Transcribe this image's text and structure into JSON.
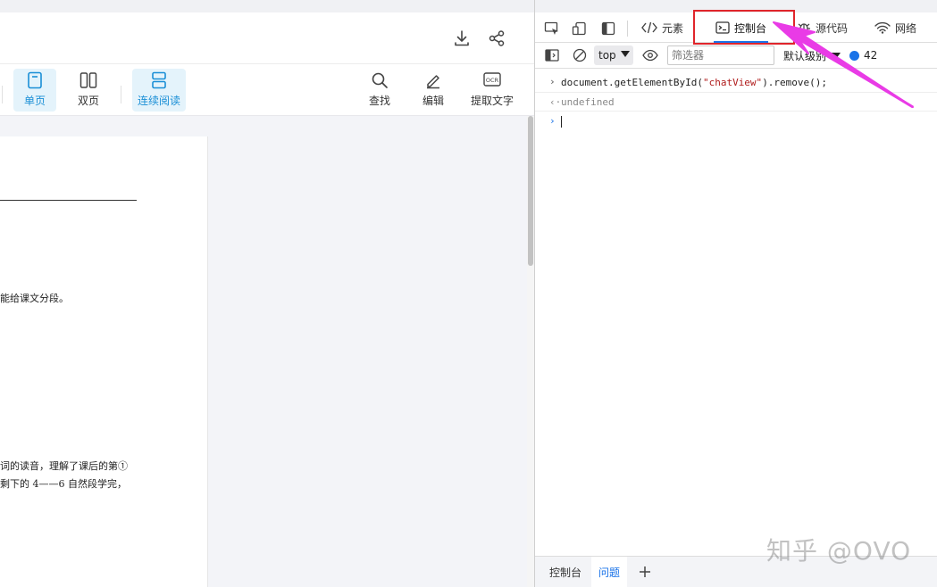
{
  "viewer": {
    "header_icons": [
      "download-icon",
      "share-icon"
    ],
    "toolbar": {
      "single_page": "单页",
      "double_page": "双页",
      "continuous": "连续阅读",
      "find": "查找",
      "edit": "编辑",
      "ocr": "提取文字",
      "ocr_badge": "OCR"
    },
    "page_lines": {
      "line1": "能给课文分段。",
      "line2": "词的读音，理解了课后的第①",
      "line3": "剩下的 4——6 自然段学完，"
    }
  },
  "devtools": {
    "tabs": {
      "elements": "元素",
      "console": "控制台",
      "sources": "源代码",
      "network": "网络"
    },
    "console_toolbar": {
      "context": "top",
      "filter_placeholder": "筛选器",
      "level": "默认级别",
      "issues_count": "42"
    },
    "console": {
      "input_prefix": "›",
      "input_code_before": "document.getElementById(",
      "input_code_string": "\"chatView\"",
      "input_code_after": ").remove();",
      "output_prefix": "‹·",
      "output_value": "undefined",
      "prompt_prefix": "›"
    },
    "drawer": {
      "console_tab": "控制台",
      "issues_tab": "问题",
      "add_label": "+"
    }
  },
  "watermark": "知乎 @OVO",
  "colors": {
    "accent_blue": "#1a73e8",
    "viewer_active": "#1a8fd6",
    "highlight_red": "#e0252b",
    "arrow_magenta": "#e93be6"
  }
}
